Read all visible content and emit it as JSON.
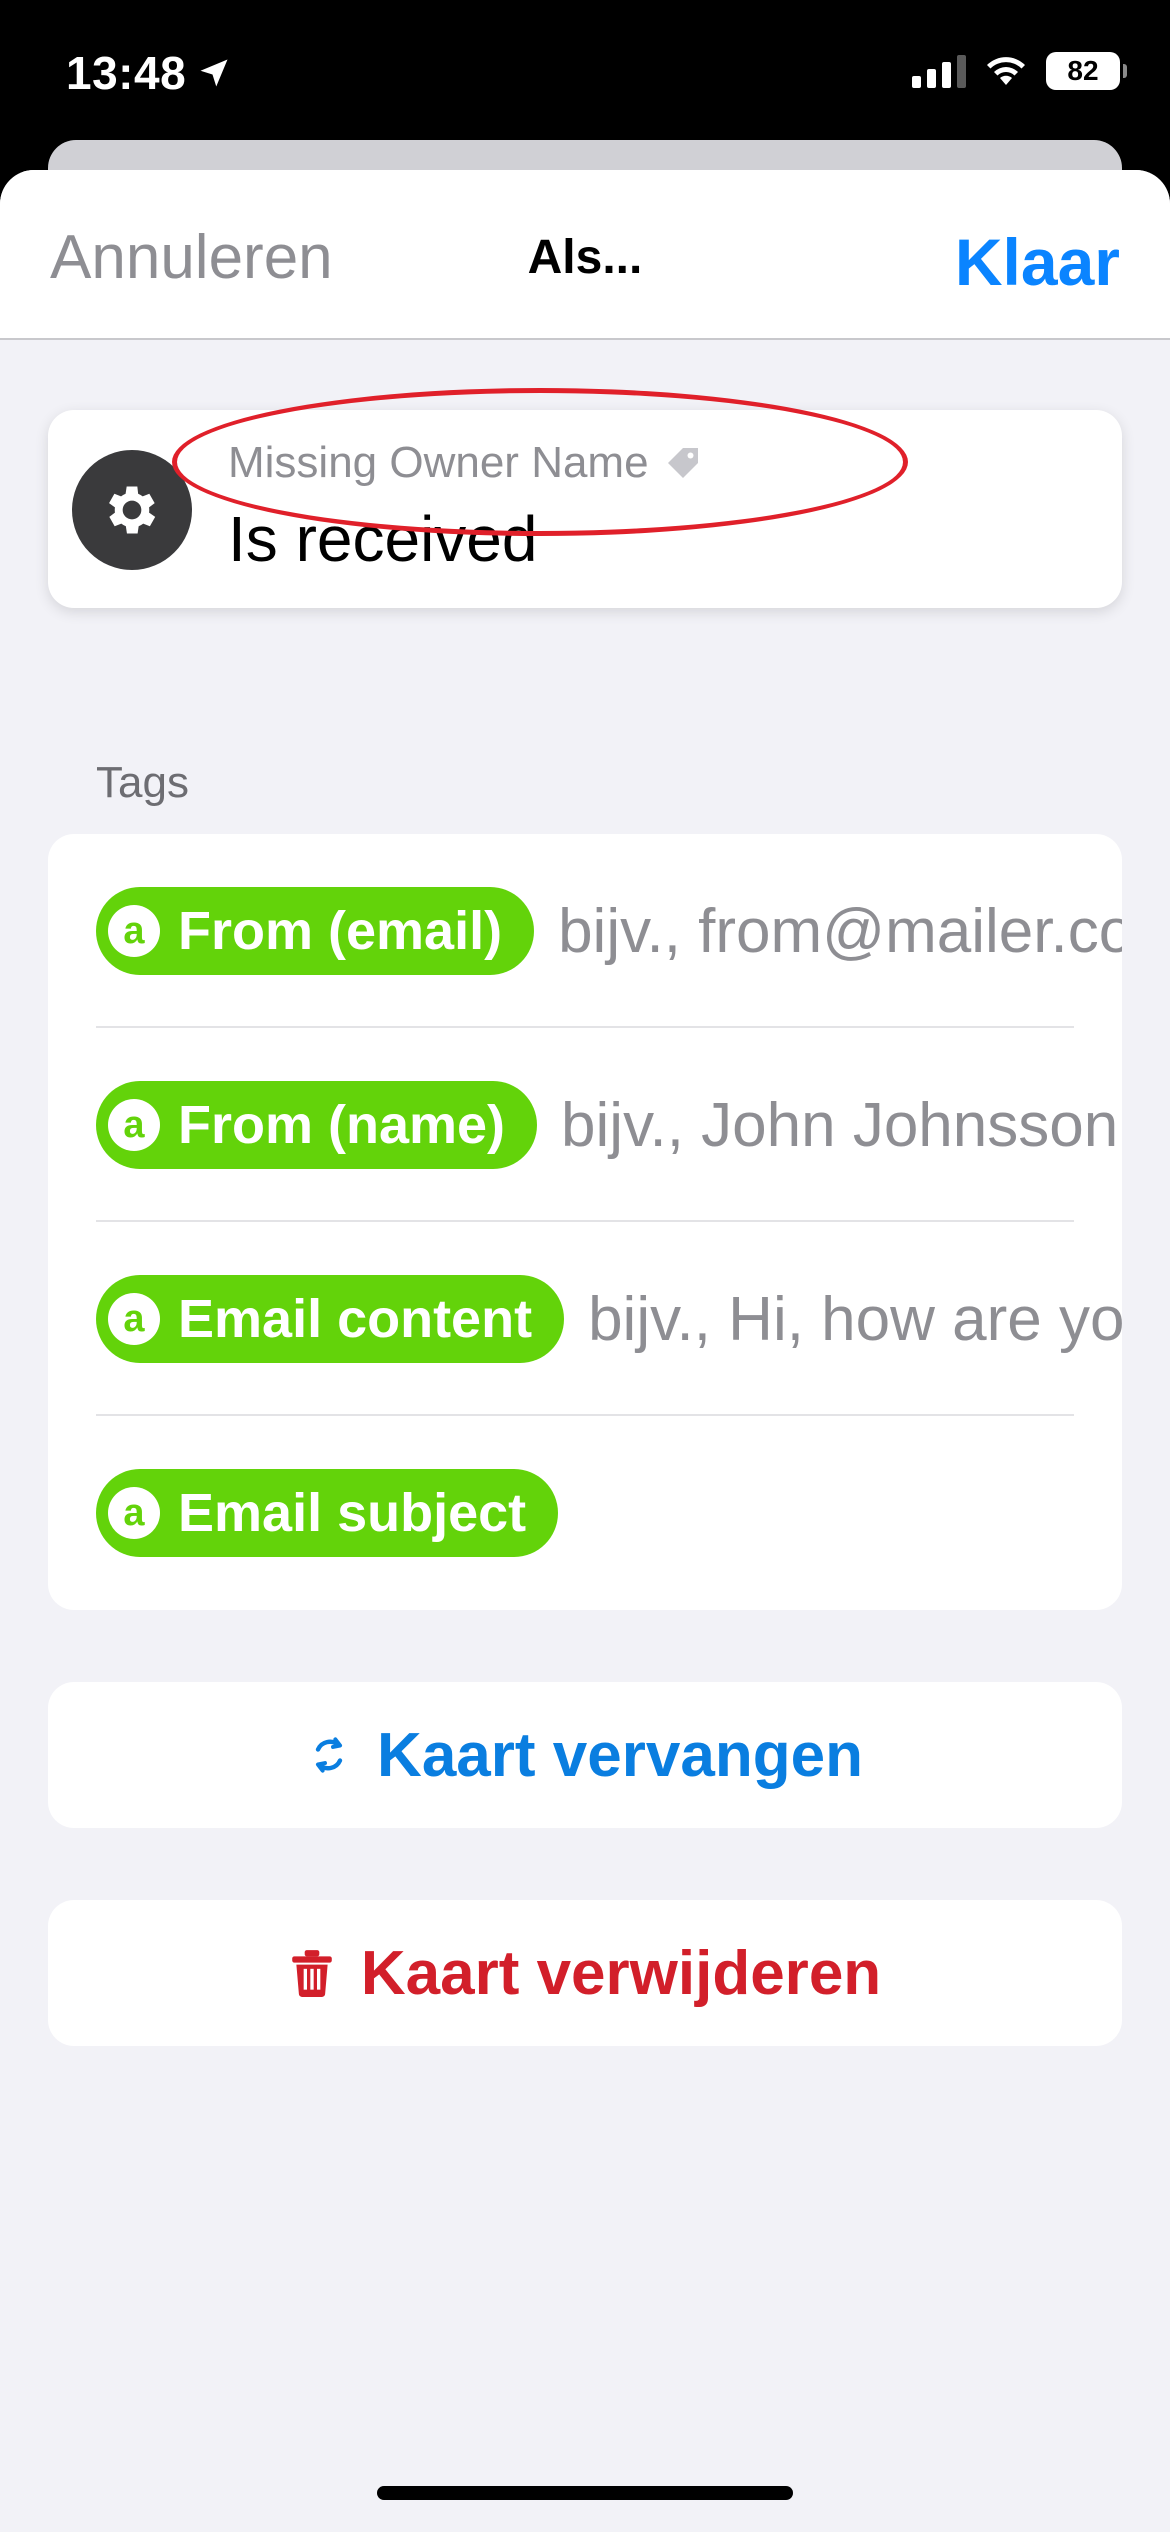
{
  "status_bar": {
    "time": "13:48",
    "battery": "82"
  },
  "nav": {
    "cancel_label": "Annuleren",
    "title": "Als...",
    "done_label": "Klaar"
  },
  "trigger": {
    "owner": "Missing Owner Name",
    "label": "Is received",
    "icon": "gear-icon"
  },
  "tags_section": {
    "label": "Tags",
    "items": [
      {
        "name": "From (email)",
        "placeholder": "bijv., from@mailer.co"
      },
      {
        "name": "From (name)",
        "placeholder": "bijv., John Johnsson"
      },
      {
        "name": "Email content",
        "placeholder": "bijv., Hi, how are you"
      },
      {
        "name": "Email subject",
        "placeholder": ""
      }
    ],
    "badge_glyph": "a"
  },
  "actions": {
    "replace_label": "Kaart vervangen",
    "delete_label": "Kaart verwijderen"
  },
  "colors": {
    "accent_blue": "#0a84ff",
    "tag_green": "#63d30a",
    "danger_red": "#d21f2a",
    "annotation_red": "#e0202a"
  }
}
